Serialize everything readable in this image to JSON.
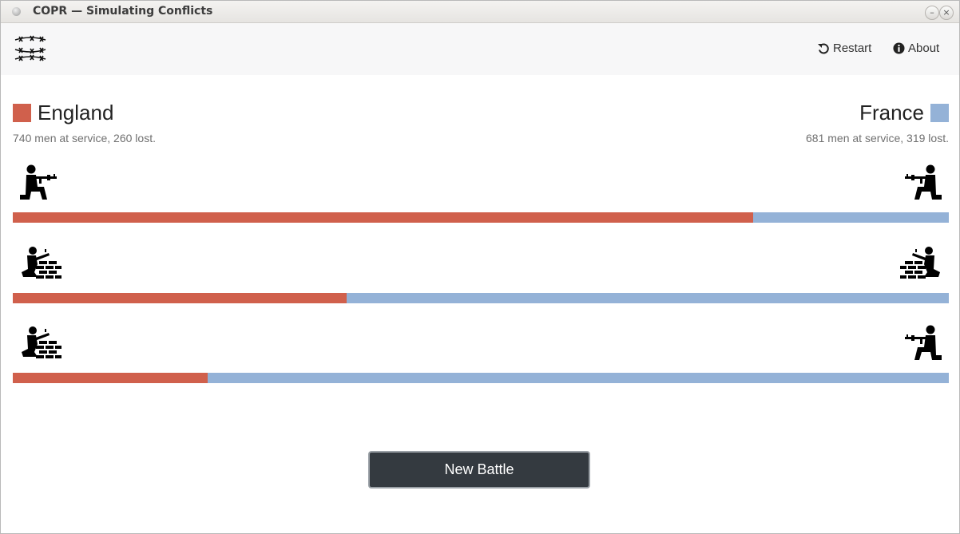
{
  "window": {
    "title": "COPR — Simulating Conflicts"
  },
  "nav": {
    "restart_label": "Restart",
    "about_label": "About"
  },
  "colors": {
    "england": "#d0604c",
    "france": "#94b2d7"
  },
  "england": {
    "name": "England",
    "stats": "740 men at service, 260 lost."
  },
  "france": {
    "name": "France",
    "stats": "681 men at service, 319 lost."
  },
  "battles": [
    {
      "england_unit": "infantry-icon",
      "france_unit": "infantry-icon",
      "england_share": 0.791
    },
    {
      "england_unit": "fortified-icon",
      "france_unit": "fortified-icon",
      "england_share": 0.357
    },
    {
      "england_unit": "fortified-icon",
      "france_unit": "infantry-icon",
      "england_share": 0.208
    }
  ],
  "actions": {
    "new_battle_label": "New Battle"
  }
}
